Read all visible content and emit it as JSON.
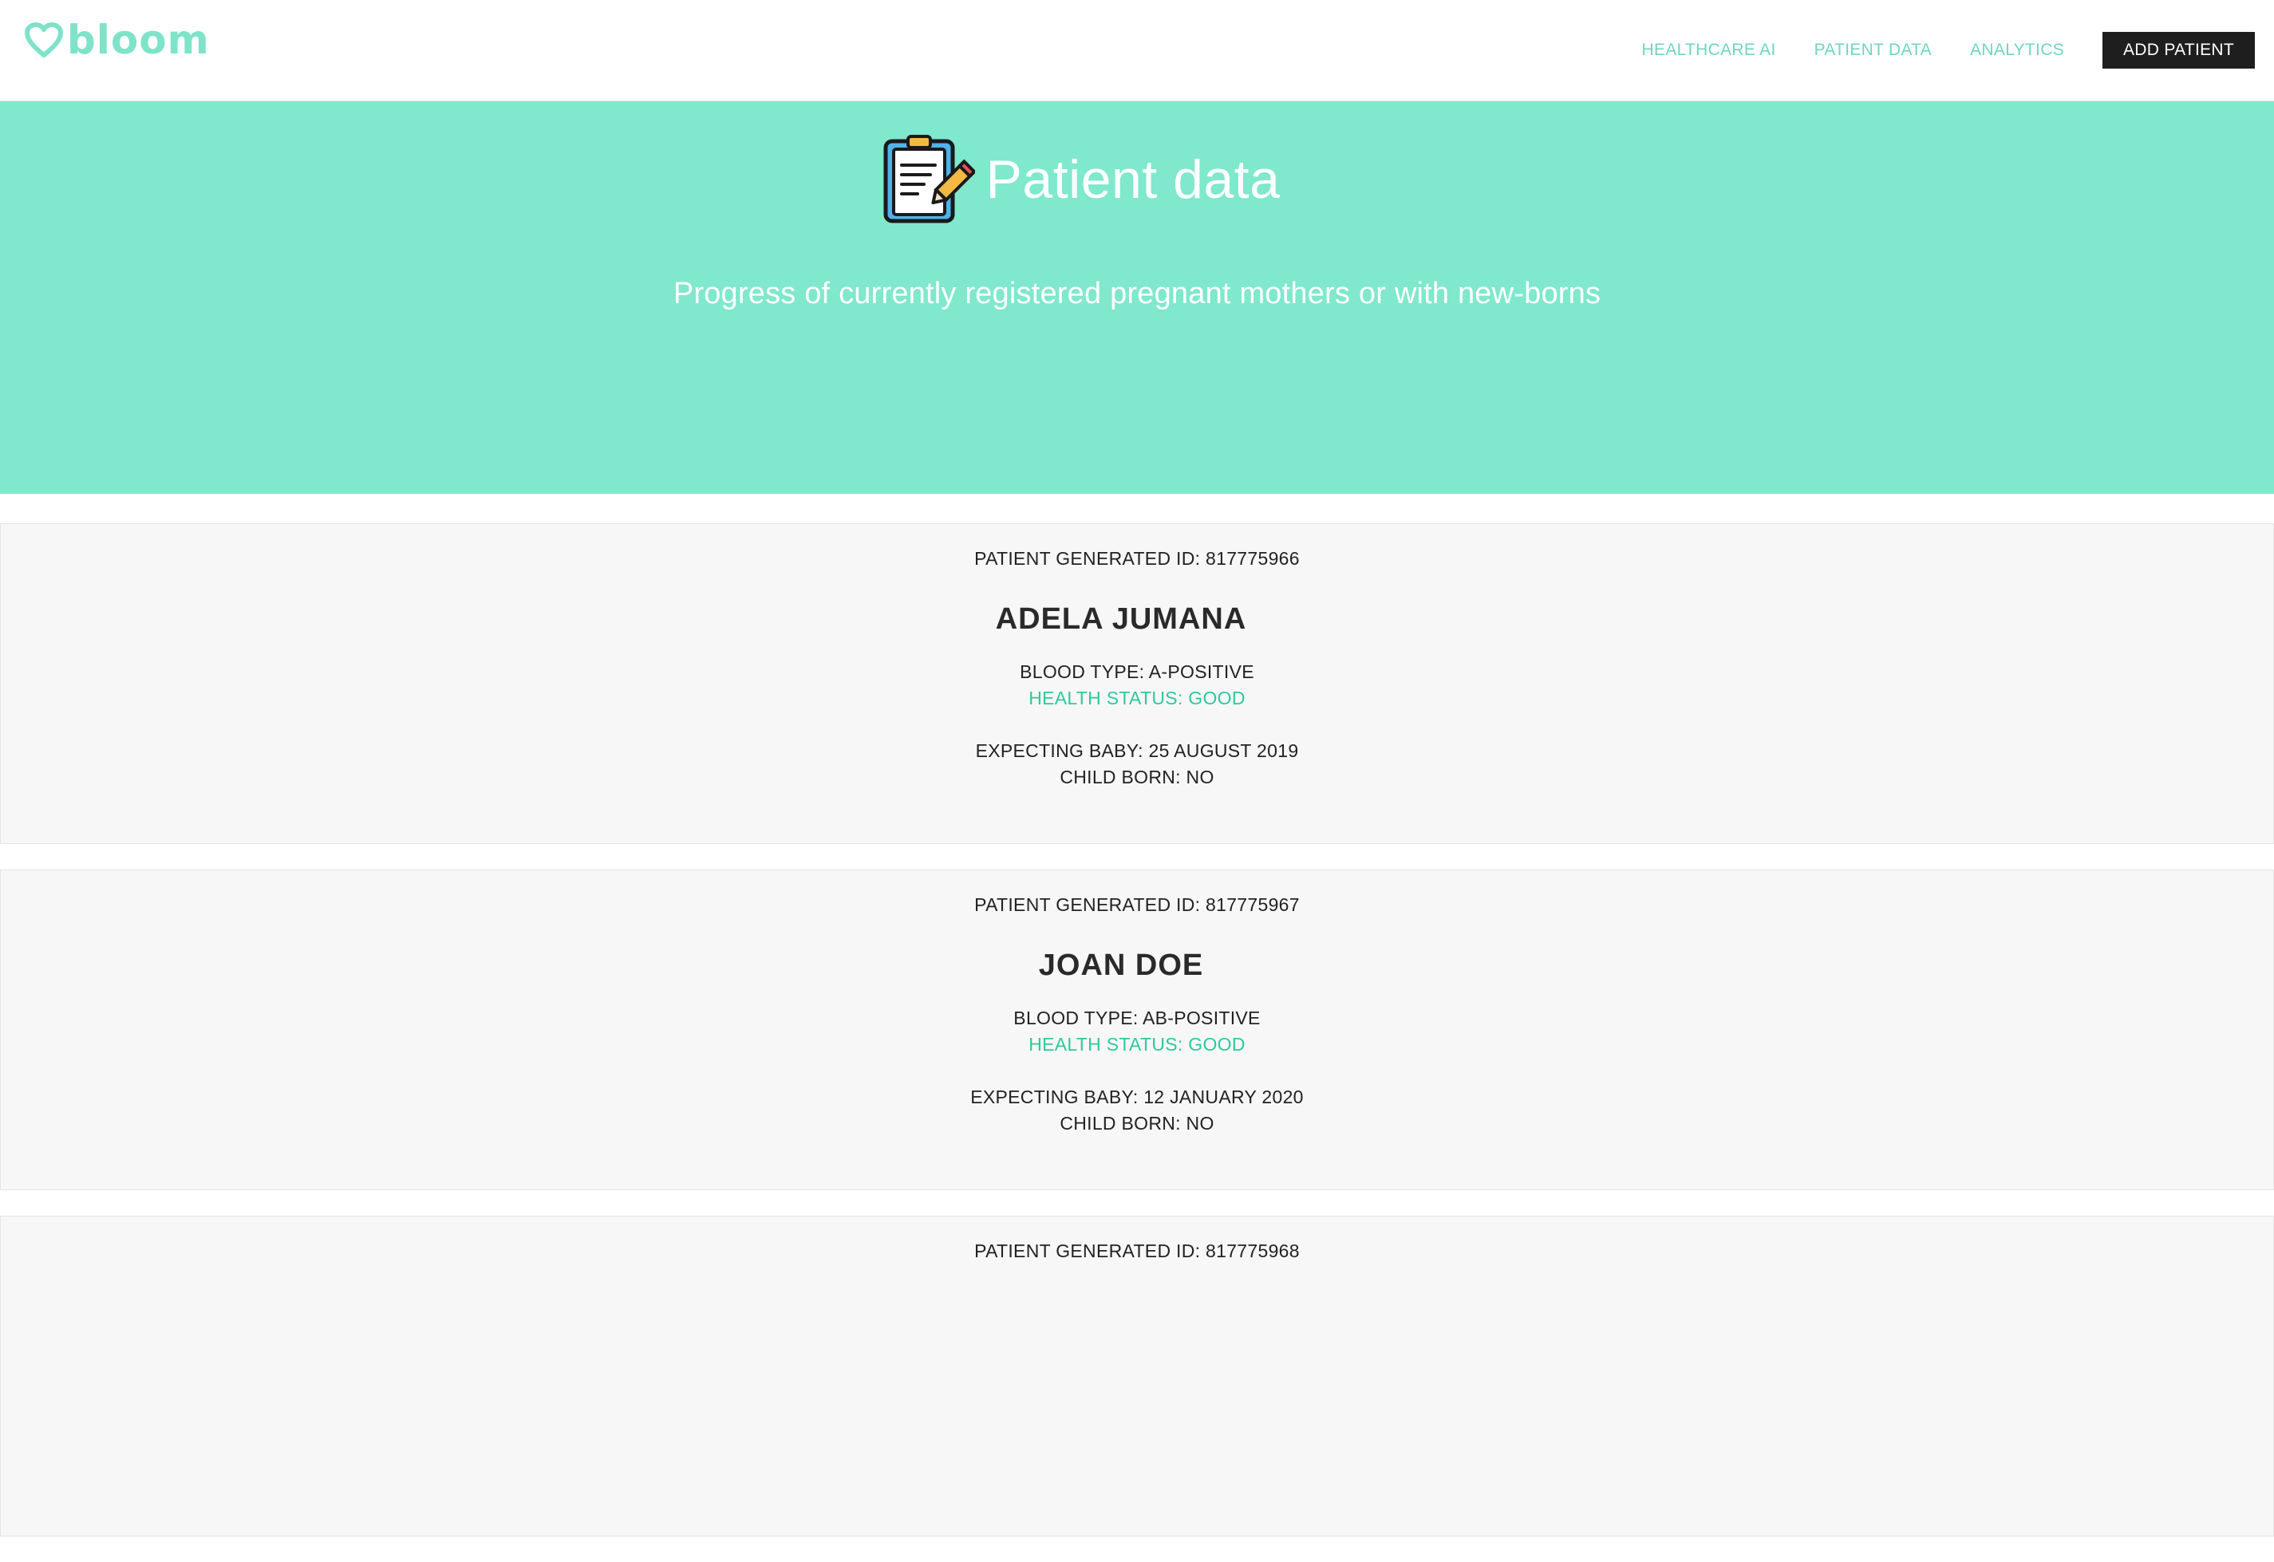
{
  "brand": {
    "name": "bloom",
    "logo_icon": "heart-icon",
    "accent_color": "#7ee3c8"
  },
  "nav": {
    "links": [
      "HEALTHCARE AI",
      "PATIENT DATA",
      "ANALYTICS"
    ],
    "cta_label": "ADD PATIENT"
  },
  "hero": {
    "icon": "clipboard-pencil-icon",
    "title": "Patient data",
    "subtitle": "Progress of currently registered pregnant mothers or with new-borns",
    "background": "#7fe8cd"
  },
  "patients": [
    {
      "id_text": "PATIENT GENERATED ID: 817775966",
      "name": "ADELA JUMANA",
      "blood_type": "BLOOD TYPE: A-POSITIVE",
      "health_status": "HEALTH STATUS: GOOD",
      "expecting": "EXPECTING BABY: 25 AUGUST 2019",
      "child_born": "CHILD BORN: NO"
    },
    {
      "id_text": "PATIENT GENERATED ID: 817775967",
      "name": "JOAN DOE",
      "blood_type": "BLOOD TYPE: AB-POSITIVE",
      "health_status": "HEALTH STATUS: GOOD",
      "expecting": "EXPECTING BABY: 12 JANUARY 2020",
      "child_born": "CHILD BORN: NO"
    },
    {
      "id_text": "PATIENT GENERATED ID: 817775968"
    }
  ]
}
